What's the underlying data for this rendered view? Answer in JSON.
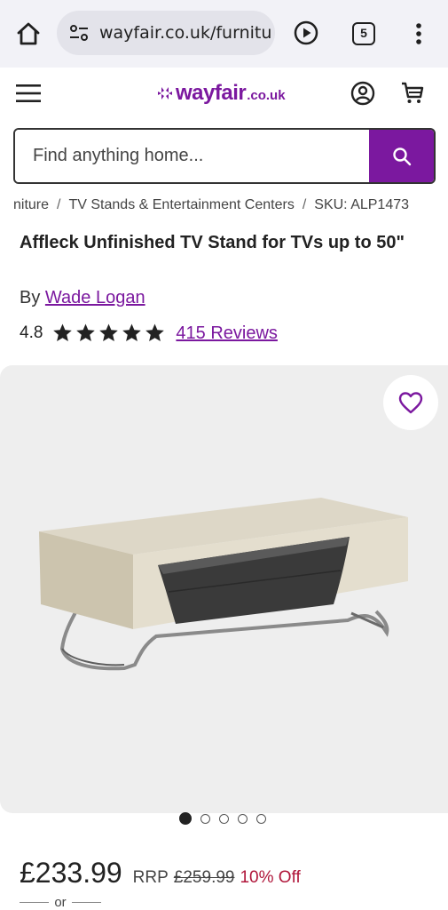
{
  "browser": {
    "url": "wayfair.co.uk/furnitu",
    "tab_count": "5",
    "icons": [
      "home-icon",
      "site-settings-icon",
      "play-icon",
      "tab-switcher-icon",
      "more-menu-icon"
    ]
  },
  "header": {
    "logo_word": "wayfair",
    "logo_tld": ".co.uk",
    "brand_color": "#7b189f",
    "icons": [
      "hamburger-menu-icon",
      "account-icon",
      "cart-icon"
    ]
  },
  "search": {
    "placeholder": "Find anything home..."
  },
  "breadcrumb": {
    "items": [
      "niture",
      "TV Stands & Entertainment Centers",
      "SKU: ALP1473"
    ],
    "separator": "/"
  },
  "product": {
    "title": "Affleck Unfinished TV Stand for TVs up to 50\"",
    "by_label": "By",
    "brand": "Wade Logan",
    "rating": "4.8",
    "star_count": 5,
    "reviews": "415 Reviews",
    "gallery": {
      "total_images": 5,
      "active_index": 0
    }
  },
  "price": {
    "current": "£233.99",
    "rrp_label": "RRP",
    "rrp": "£259.99",
    "discount": "10% Off",
    "discount_color": "#b0163a",
    "or_label": "or"
  }
}
